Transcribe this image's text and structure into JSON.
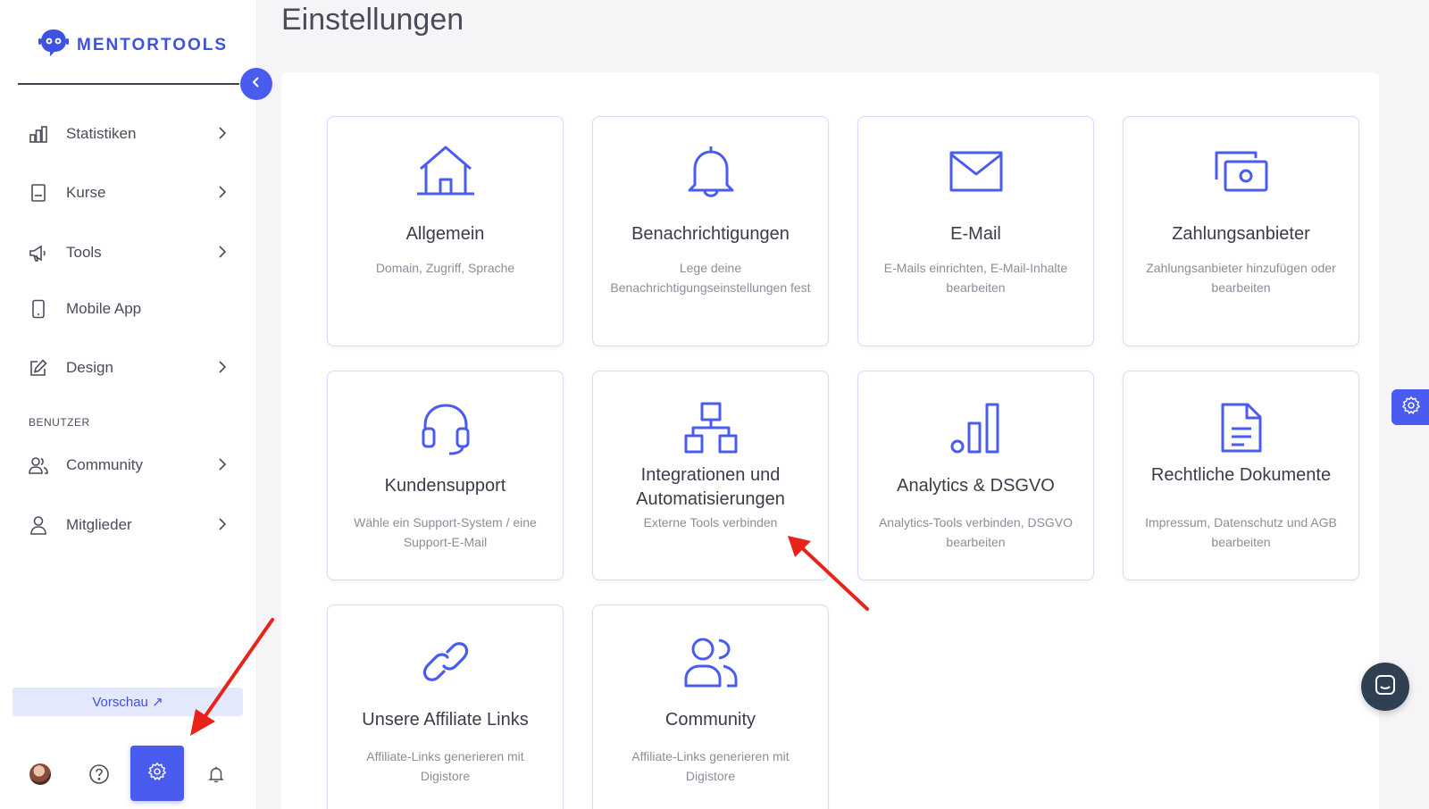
{
  "app": {
    "logo_text": "MENTORTOOLS",
    "page_title": "Einstellungen"
  },
  "sidebar": {
    "items": [
      {
        "label": "Statistiken",
        "icon": "bar-chart-icon",
        "has_submenu": true
      },
      {
        "label": "Kurse",
        "icon": "book-icon",
        "has_submenu": true
      },
      {
        "label": "Tools",
        "icon": "megaphone-icon",
        "has_submenu": true
      },
      {
        "label": "Mobile App",
        "icon": "mobile-phone-icon",
        "has_submenu": false
      },
      {
        "label": "Design",
        "icon": "pencil-edit-icon",
        "has_submenu": true
      }
    ],
    "section_label": "BENUTZER",
    "user_items": [
      {
        "label": "Community",
        "icon": "users-icon",
        "has_submenu": true
      },
      {
        "label": "Mitglieder",
        "icon": "user-icon",
        "has_submenu": true
      }
    ],
    "preview_label": "Vorschau ↗"
  },
  "cards": [
    {
      "title": "Allgemein",
      "desc": "Domain, Zugriff, Sprache",
      "icon": "home-icon"
    },
    {
      "title": "Benachrichtigungen",
      "desc": "Lege deine Benachrichtigungseinstellungen fest",
      "icon": "bell-icon"
    },
    {
      "title": "E-Mail",
      "desc": "E-Mails einrichten, E-Mail-Inhalte bearbeiten",
      "icon": "envelope-icon"
    },
    {
      "title": "Zahlungsanbieter",
      "desc": "Zahlungsanbieter hinzufügen oder bearbeiten",
      "icon": "payment-cash-icon"
    },
    {
      "title": "Kundensupport",
      "desc": "Wähle ein Support-System / eine Support-E-Mail",
      "icon": "headset-icon"
    },
    {
      "title": "Integrationen und Automatisierungen",
      "desc": "Externe Tools verbinden",
      "icon": "network-hierarchy-icon"
    },
    {
      "title": "Analytics & DSGVO",
      "desc": "Analytics-Tools verbinden, DSGVO bearbeiten",
      "icon": "analytics-bars-icon"
    },
    {
      "title": "Rechtliche Dokumente",
      "desc": "Impressum, Datenschutz und AGB bearbeiten",
      "icon": "document-icon"
    },
    {
      "title": "Unsere Affiliate Links",
      "desc": "Affiliate-Links generieren mit Digistore",
      "icon": "link-icon"
    },
    {
      "title": "Community",
      "desc": "Affiliate-Links generieren mit Digistore",
      "icon": "community-users-icon"
    }
  ],
  "colors": {
    "accent": "#4a5cf0",
    "brand": "#3d52e0",
    "annotation_arrow": "#e8231a",
    "chat": "#2f4052"
  }
}
